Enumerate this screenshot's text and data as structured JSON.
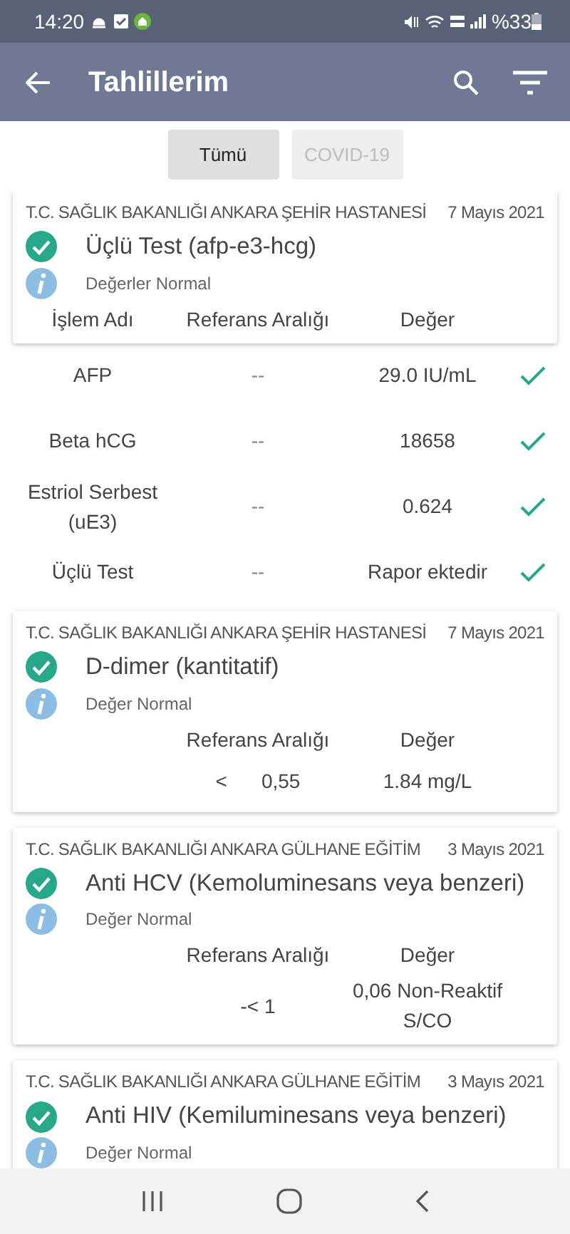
{
  "status_bar": {
    "time": "14:20",
    "battery": "%33"
  },
  "app_bar": {
    "title": "Tahlillerim"
  },
  "tabs": [
    {
      "label": "Tümü",
      "selected": true
    },
    {
      "label": "COVID-19",
      "selected": false
    }
  ],
  "results": [
    {
      "hospital": "T.C. SAĞLIK BAKANLIĞI ANKARA ŞEHİR HASTANESİ",
      "date": "7 Mayıs 2021",
      "test": "Üçlü Test (afp-e3-hcg)",
      "status": "Değerler Normal",
      "rows_in_card": false,
      "headers": {
        "name": "İşlem Adı",
        "reference": "Referans Aralığı",
        "value": "Değer"
      },
      "rows": [
        {
          "name": "AFP",
          "reference": "--",
          "value": "29.0 IU/mL",
          "ok": true
        },
        {
          "name": "Beta hCG",
          "reference": "--",
          "value": "18658",
          "ok": true
        },
        {
          "name": "Estriol Serbest (uE3)",
          "reference": "--",
          "value": "0.624",
          "ok": true
        },
        {
          "name": "Üçlü Test",
          "reference": "--",
          "value": "Rapor ektedir",
          "ok": true
        }
      ]
    },
    {
      "hospital": "T.C. SAĞLIK BAKANLIĞI ANKARA ŞEHİR HASTANESİ",
      "date": "7 Mayıs 2021",
      "test": "D-dimer (kantitatif)",
      "status": "Değer Normal",
      "rows_in_card": true,
      "headers": {
        "reference": "Referans Aralığı",
        "value": "Değer"
      },
      "rows": [
        {
          "operator": "<",
          "reference": "0,55",
          "value": "1.84 mg/L",
          "ok": false
        }
      ]
    },
    {
      "hospital": "T.C. SAĞLIK BAKANLIĞI ANKARA GÜLHANE EĞİTİM",
      "date": "3 Mayıs 2021",
      "test": "Anti HCV (Kemoluminesans veya benzeri)",
      "status": "Değer Normal",
      "rows_in_card": true,
      "headers": {
        "reference": "Referans Aralığı",
        "value": "Değer"
      },
      "rows": [
        {
          "reference": "-< 1",
          "value": "0,06 Non-Reaktif S/CO",
          "ok": false
        }
      ]
    },
    {
      "hospital": "T.C. SAĞLIK BAKANLIĞI ANKARA GÜLHANE EĞİTİM",
      "date": "3 Mayıs 2021",
      "test": "Anti HIV (Kemiluminesans veya benzeri)",
      "status": "Değer Normal"
    }
  ]
}
